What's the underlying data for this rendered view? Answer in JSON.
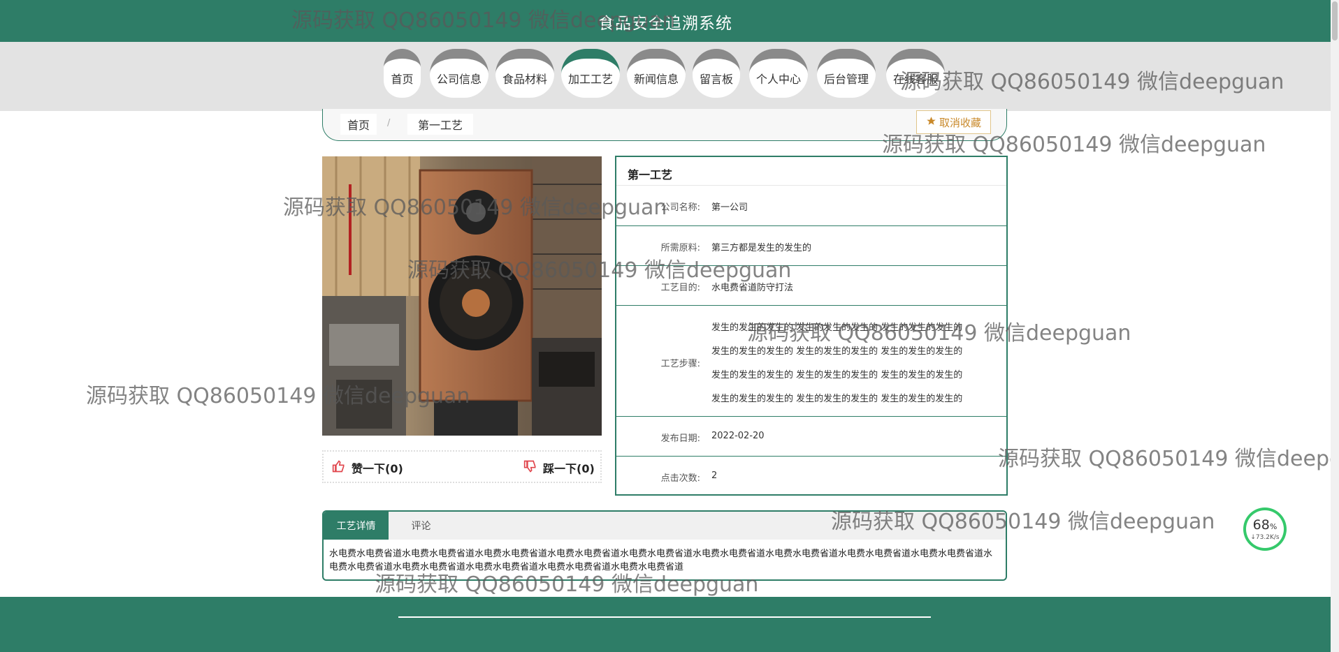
{
  "header": {
    "site_title": "食品安全追溯系统"
  },
  "nav": {
    "items": [
      {
        "label": "首页"
      },
      {
        "label": "公司信息"
      },
      {
        "label": "食品材料"
      },
      {
        "label": "加工工艺"
      },
      {
        "label": "新闻信息"
      },
      {
        "label": "留言板"
      },
      {
        "label": "个人中心"
      },
      {
        "label": "后台管理"
      },
      {
        "label": "在线客服"
      }
    ]
  },
  "breadcrumb": {
    "home": "首页",
    "separator": "/",
    "current": "第一工艺"
  },
  "favorite": {
    "label": "取消收藏",
    "icon": "star-icon"
  },
  "vote": {
    "like_label": "赞一下(0)",
    "dislike_label": "踩一下(0)"
  },
  "detail": {
    "title": "第一工艺",
    "fields": [
      {
        "label": "公司名称:",
        "value": "第一公司"
      },
      {
        "label": "所需原料:",
        "value": "第三方都是发生的发生的"
      },
      {
        "label": "工艺目的:",
        "value": "水电费省道防守打法"
      },
      {
        "label": "工艺步骤:",
        "lines": [
          "发生的发生的发生的 发生的发生的发生的 发生的发生的发生的",
          "发生的发生的发生的 发生的发生的发生的 发生的发生的发生的",
          "发生的发生的发生的 发生的发生的发生的 发生的发生的发生的",
          "发生的发生的发生的 发生的发生的发生的 发生的发生的发生的"
        ]
      },
      {
        "label": "发布日期:",
        "value": "2022-02-20"
      },
      {
        "label": "点击次数:",
        "value": "2"
      }
    ]
  },
  "tabs": {
    "items": [
      {
        "label": "工艺详情"
      },
      {
        "label": "评论"
      }
    ],
    "content": "水电费水电费省道水电费水电费省道水电费水电费省道水电费水电费省道水电费水电费省道水电费水电费省道水电费水电费省道水电费水电费省道水电费水电费省道水电费水电费省道水电费水电费省道水电费水电费省道水电费水电费省道水电费水电费省道"
  },
  "speed_widget": {
    "percent": "68",
    "percent_unit": "%",
    "rate": "↓73.2K/s"
  },
  "watermark": "源码获取 QQ86050149 微信deepguan",
  "colors": {
    "primary": "#2e7d67",
    "nav_band": "#e3e3e3",
    "favorite": "#c9892a",
    "like": "#e0444b"
  }
}
